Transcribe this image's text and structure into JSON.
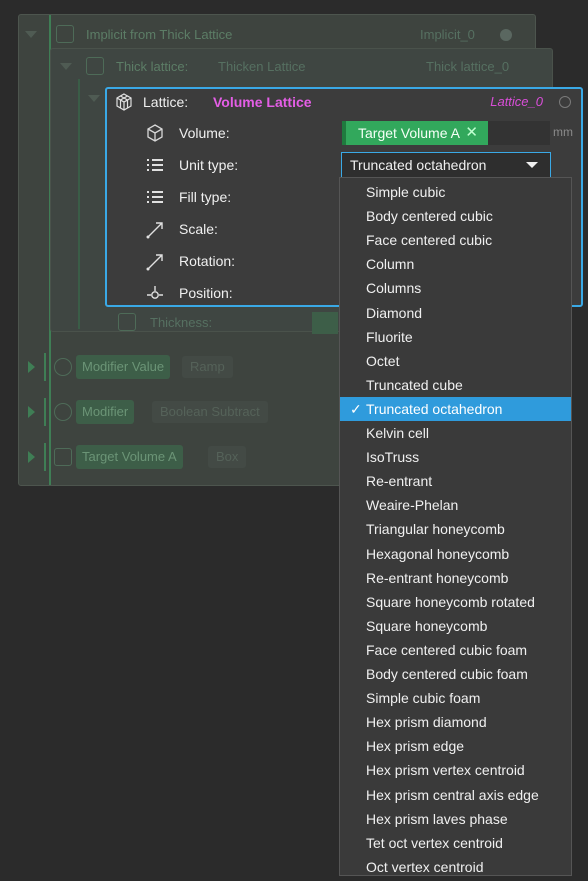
{
  "background": {
    "implicit_row": {
      "label": "Implicit from Thick Lattice",
      "id": "Implicit_0"
    },
    "thick_row": {
      "label": "Thick lattice:",
      "name": "Thicken Lattice",
      "id": "Thick lattice_0"
    },
    "thickness_label": "Thickness:",
    "modifier_value": {
      "label": "Modifier Value",
      "tag": "Ramp"
    },
    "modifier": {
      "label": "Modifier",
      "tag": "Boolean Subtract"
    },
    "target_volume": {
      "label": "Target Volume A",
      "tag": "Box"
    }
  },
  "lattice_panel": {
    "label": "Lattice:",
    "name": "Volume Lattice",
    "id": "Lattice_0",
    "volume": {
      "label": "Volume:",
      "value": "Target Volume A",
      "clear_glyph": "✕",
      "unit": "mm"
    },
    "unit_type": {
      "label": "Unit type:",
      "value": "Truncated octahedron"
    },
    "fill_type": {
      "label": "Fill type:"
    },
    "scale": {
      "label": "Scale:"
    },
    "rotation": {
      "label": "Rotation:"
    },
    "position": {
      "label": "Position:"
    }
  },
  "dropdown": {
    "check_glyph": "✓",
    "selected_index": 9,
    "options": [
      "Simple cubic",
      "Body centered cubic",
      "Face centered cubic",
      "Column",
      "Columns",
      "Diamond",
      "Fluorite",
      "Octet",
      "Truncated cube",
      "Truncated octahedron",
      "Kelvin cell",
      "IsoTruss",
      "Re-entrant",
      "Weaire-Phelan",
      "Triangular honeycomb",
      "Hexagonal honeycomb",
      "Re-entrant honeycomb",
      "Square honeycomb rotated",
      "Square honeycomb",
      "Face centered cubic foam",
      "Body centered cubic foam",
      "Simple cubic foam",
      "Hex prism diamond",
      "Hex prism edge",
      "Hex prism vertex centroid",
      "Hex prism central axis edge",
      "Hex prism laves phase",
      "Tet oct vertex centroid",
      "Oct vertex centroid"
    ]
  },
  "colors": {
    "accent": "#3aa9e6",
    "lattice_name": "#e45ee6",
    "volume_green": "#32a85c",
    "selected_bg": "#2f9bdc"
  }
}
